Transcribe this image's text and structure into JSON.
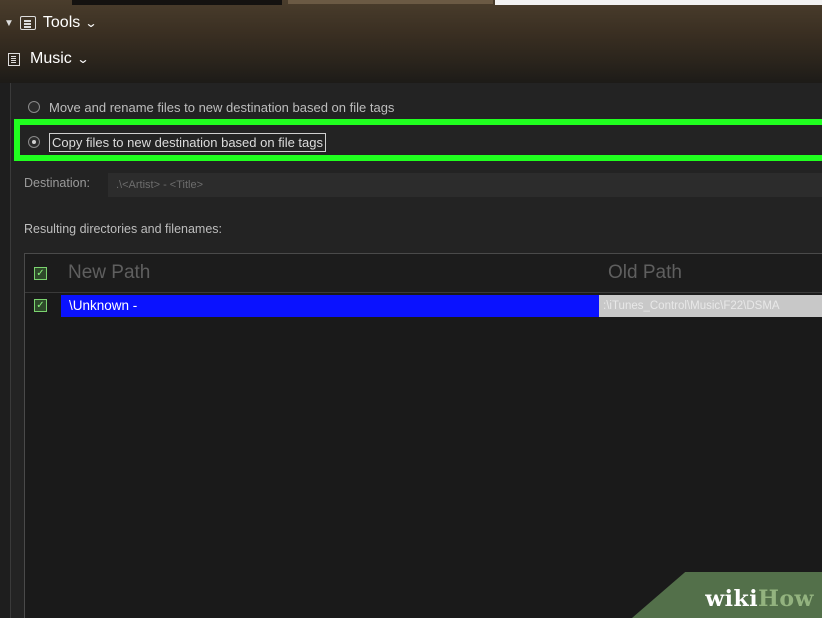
{
  "menu": {
    "tools_label": "Tools",
    "music_label": "Music"
  },
  "options": {
    "move_label": "Move and rename files to new destination based on file tags",
    "copy_label": "Copy files to new destination based on file tags",
    "selected": "copy"
  },
  "destination": {
    "label": "Destination:",
    "value": ".\\<Artist> - <Title>"
  },
  "results": {
    "label": "Resulting directories and filenames:",
    "columns": [
      "New Path",
      "Old Path"
    ],
    "rows": [
      {
        "checked": true,
        "new_path": "\\Unknown -",
        "old_path": ":\\iTunes_Control\\Music\\F22\\DSMA"
      }
    ]
  },
  "watermark": {
    "wiki": "wiki",
    "how": "How"
  },
  "colors": {
    "highlight": "#20ff1f",
    "selection": "#0a12ff",
    "header_brown": "#3a2f22"
  }
}
